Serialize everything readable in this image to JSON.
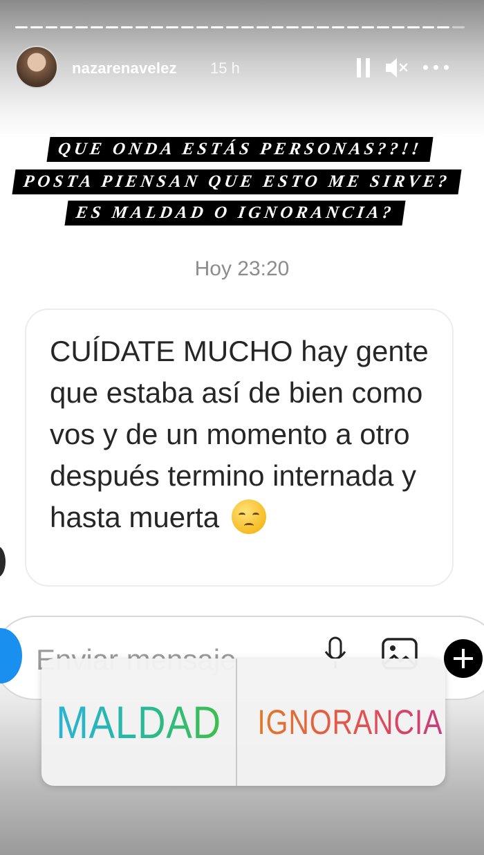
{
  "story": {
    "progress_segments": 30,
    "progress_done": 29,
    "username": "nazarenavelez",
    "time_ago": "15 h",
    "icons": [
      "pause-icon",
      "mute-icon",
      "more-options-icon"
    ]
  },
  "captions": [
    "QUE ONDA ESTÁS PERSONAS??!!",
    "POSTA PIENSAN QUE ESTO ME SIRVE?",
    "ES MALDAD O IGNORANCIA?"
  ],
  "dm": {
    "timestamp": "Hoy 23:20",
    "message": "CUÍDATE MUCHO hay gente que estaba así de bien como vos y de un momento a otro  después termino internada y hasta muerta",
    "emoji": "pensive-face-emoji"
  },
  "message_input": {
    "placeholder": "Enviar mensaje",
    "icons": [
      "camera-icon",
      "microphone-icon",
      "gallery-icon",
      "add-icon"
    ]
  },
  "poll": {
    "options": [
      "MALDAD",
      "IGNORANCIA"
    ]
  },
  "colors": {
    "camera_button": "#1990f0",
    "caption_bg": "#000000"
  }
}
